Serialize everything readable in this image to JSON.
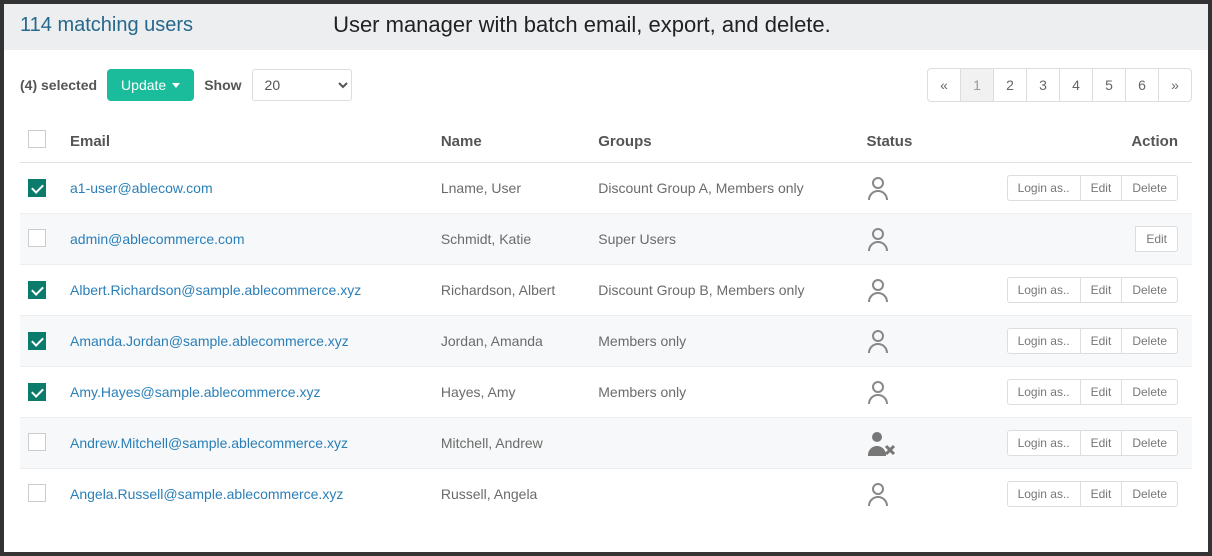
{
  "header": {
    "matching": "114 matching users",
    "title": "User manager with batch email, export, and delete."
  },
  "toolbar": {
    "selected_label": "(4) selected",
    "update_label": "Update",
    "show_label": "Show",
    "page_size": "20"
  },
  "pager": {
    "pages": [
      "«",
      "1",
      "2",
      "3",
      "4",
      "5",
      "6",
      "»"
    ],
    "active_index": 1
  },
  "columns": {
    "email": "Email",
    "name": "Name",
    "groups": "Groups",
    "status": "Status",
    "action": "Action"
  },
  "actions": {
    "login_as": "Login as..",
    "edit": "Edit",
    "delete": "Delete"
  },
  "rows": [
    {
      "checked": true,
      "email": "a1-user@ablecow.com",
      "name": "Lname, User",
      "groups": "Discount Group A, Members only",
      "status": "active",
      "buttons": [
        "login_as",
        "edit",
        "delete"
      ],
      "striped": false
    },
    {
      "checked": false,
      "email": "admin@ablecommerce.com",
      "name": "Schmidt, Katie",
      "groups": "Super Users",
      "status": "active",
      "buttons": [
        "edit"
      ],
      "striped": true
    },
    {
      "checked": true,
      "email": "Albert.Richardson@sample.ablecommerce.xyz",
      "name": "Richardson, Albert",
      "groups": "Discount Group B, Members only",
      "status": "active",
      "buttons": [
        "login_as",
        "edit",
        "delete"
      ],
      "striped": false
    },
    {
      "checked": true,
      "email": "Amanda.Jordan@sample.ablecommerce.xyz",
      "name": "Jordan, Amanda",
      "groups": "Members only",
      "status": "active",
      "buttons": [
        "login_as",
        "edit",
        "delete"
      ],
      "striped": true
    },
    {
      "checked": true,
      "email": "Amy.Hayes@sample.ablecommerce.xyz",
      "name": "Hayes, Amy",
      "groups": "Members only",
      "status": "active",
      "buttons": [
        "login_as",
        "edit",
        "delete"
      ],
      "striped": false
    },
    {
      "checked": false,
      "email": "Andrew.Mitchell@sample.ablecommerce.xyz",
      "name": "Mitchell, Andrew",
      "groups": "",
      "status": "disabled",
      "buttons": [
        "login_as",
        "edit",
        "delete"
      ],
      "striped": true
    },
    {
      "checked": false,
      "email": "Angela.Russell@sample.ablecommerce.xyz",
      "name": "Russell, Angela",
      "groups": "",
      "status": "active",
      "buttons": [
        "login_as",
        "edit",
        "delete"
      ],
      "striped": false
    }
  ]
}
